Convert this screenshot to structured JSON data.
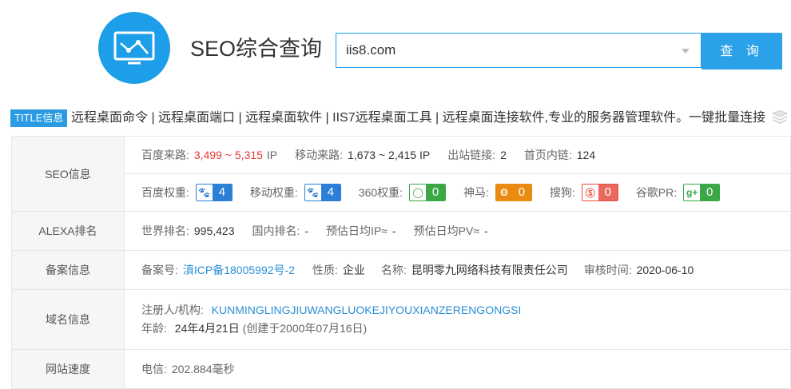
{
  "header": {
    "logo_icon": "chart-line-icon",
    "title": "SEO综合查询",
    "search_value": "iis8.com",
    "search_button": "查 询"
  },
  "title_info": {
    "badge": "TITLE信息",
    "text": "远程桌面命令 | 远程桌面端口 | 远程桌面软件 | IIS7远程桌面工具 | 远程桌面连接软件,专业的服务器管理软件。一键批量连接"
  },
  "seo": {
    "label": "SEO信息",
    "baidu_traffic_label": "百度来路:",
    "baidu_traffic_value": "3,499 ~ 5,315",
    "baidu_traffic_unit": "IP",
    "mobile_traffic_label": "移动来路:",
    "mobile_traffic_value": "1,673 ~ 2,415 IP",
    "outlinks_label": "出站链接:",
    "outlinks_value": "2",
    "inlinks_label": "首页内链:",
    "inlinks_value": "124",
    "weights": [
      {
        "label": "百度权重:",
        "value": "4",
        "icon": "paw-icon",
        "color": "#2b7fd6"
      },
      {
        "label": "移动权重:",
        "value": "4",
        "icon": "paw-icon",
        "color": "#2b7fd6"
      },
      {
        "label": "360权重:",
        "value": "0",
        "icon": "360-icon",
        "color": "#3aa845"
      },
      {
        "label": "神马:",
        "value": "0",
        "icon": "shenma-icon",
        "color": "#ea8a10"
      },
      {
        "label": "搜狗:",
        "value": "0",
        "icon": "sogou-icon",
        "color": "#e94d3e"
      },
      {
        "label": "谷歌PR:",
        "value": "0",
        "icon": "google-plus-icon",
        "color": "#3aa845"
      }
    ]
  },
  "alexa": {
    "label": "ALEXA排名",
    "world_label": "世界排名:",
    "world_value": "995,423",
    "domestic_label": "国内排名:",
    "domestic_value": "-",
    "ip_label": "预估日均IP≈",
    "ip_value": "-",
    "pv_label": "预估日均PV≈",
    "pv_value": "-"
  },
  "beian": {
    "label": "备案信息",
    "no_label": "备案号:",
    "no_value": "滇ICP备18005992号-2",
    "type_label": "性质:",
    "type_value": "企业",
    "name_label": "名称:",
    "name_value": "昆明零九网络科技有限责任公司",
    "date_label": "审核时间:",
    "date_value": "2020-06-10"
  },
  "domain": {
    "label": "域名信息",
    "registrant_label": "注册人/机构:",
    "registrant_value": "KUNMINGLINGJIUWANGLUOKEJIYOUXIANZERENGONGSI",
    "age_label": "年龄:",
    "age_value": "24年4月21日",
    "created": "(创建于2000年07月16日)"
  },
  "speed": {
    "label": "网站速度",
    "telecom_label": "电信:",
    "telecom_value": "202.884毫秒"
  }
}
